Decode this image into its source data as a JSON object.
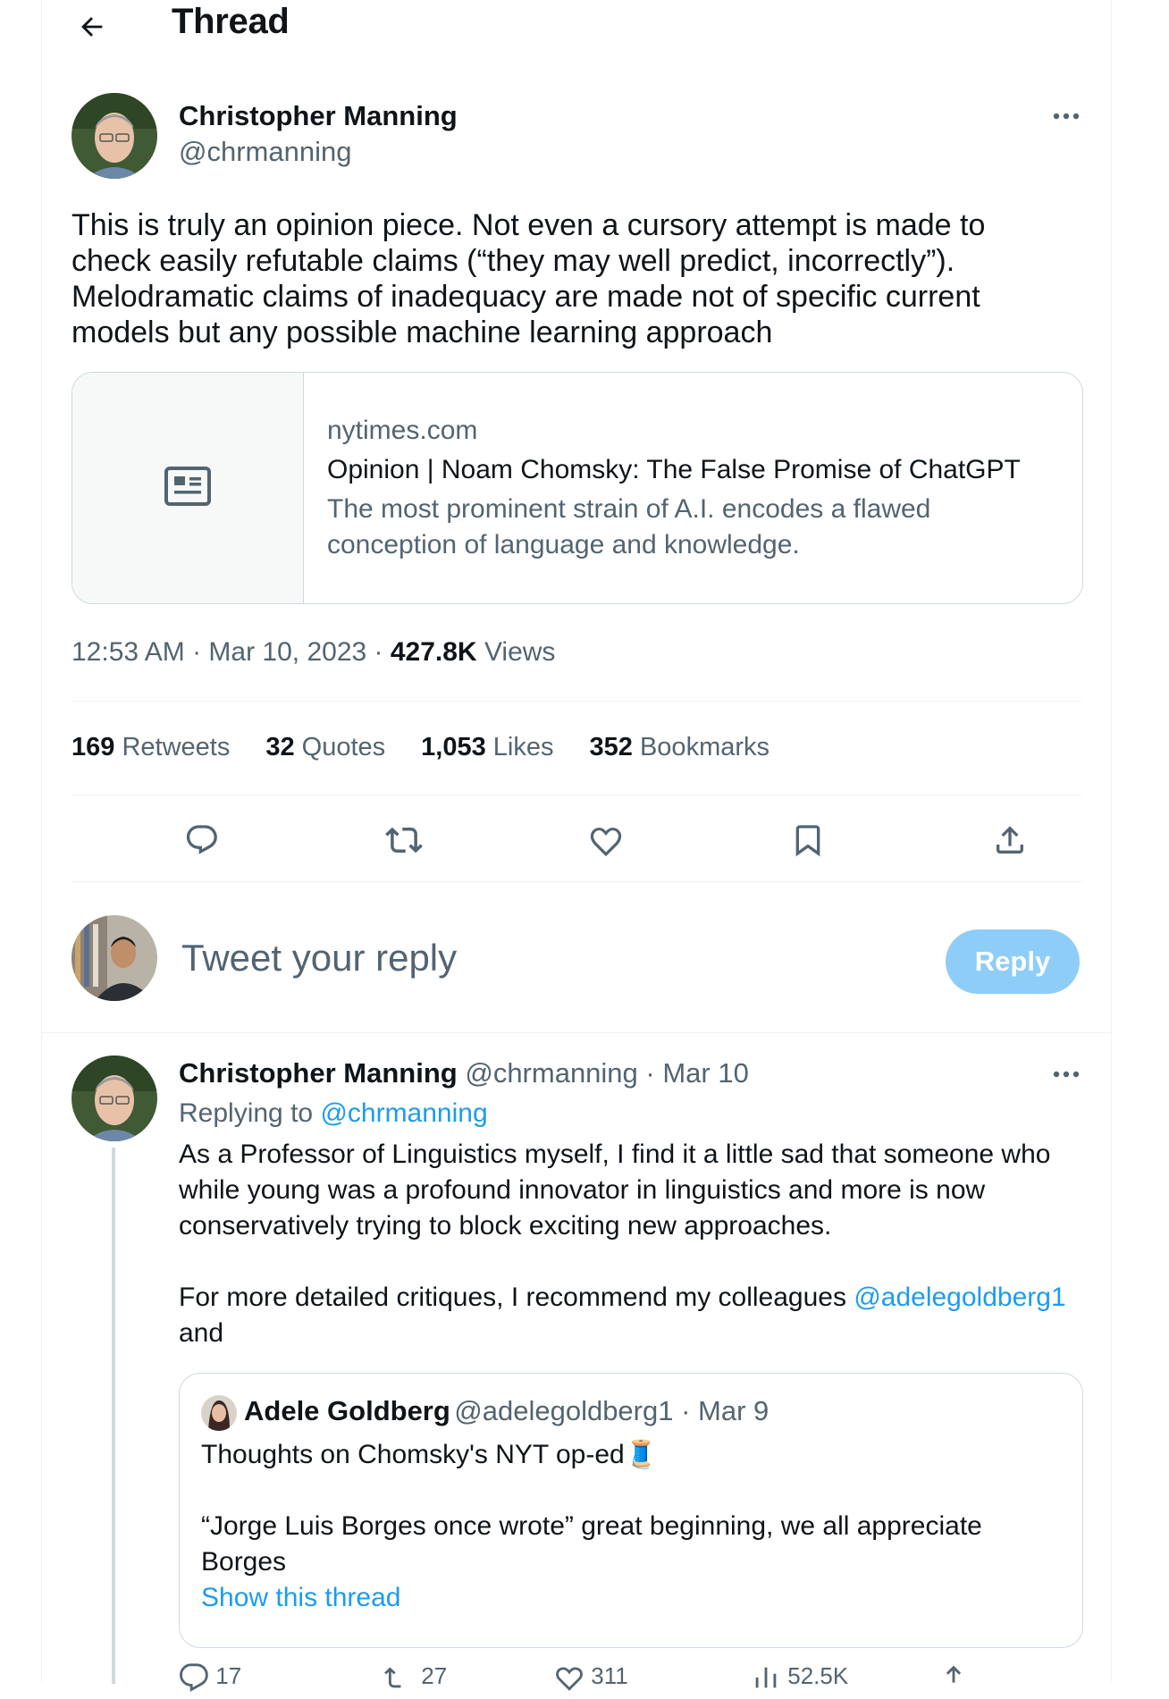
{
  "header": {
    "title": "Thread"
  },
  "main_tweet": {
    "author_name": "Christopher Manning",
    "author_handle": "@chrmanning",
    "text_lines": [
      "This is truly an opinion piece. Not even a cursory attempt is made to",
      "check easily refutable claims (“they may well predict, incorrectly”).",
      "Melodramatic claims of inadequacy are made not of specific current",
      "models but any possible machine learning approach"
    ],
    "card": {
      "domain": "nytimes.com",
      "title": "Opinion | Noam Chomsky: The False Promise of ChatGPT",
      "description": "The most prominent strain of A.I. encodes a flawed conception of language and knowledge."
    },
    "time": "12:53 AM · Mar 10, 2023 · ",
    "views_count": "427.8K",
    "views_label": " Views",
    "stats": {
      "retweets_count": "169",
      "retweets_label": " Retweets",
      "quotes_count": "32",
      "quotes_label": " Quotes",
      "likes_count": "1,053",
      "likes_label": " Likes",
      "bookmarks_count": "352",
      "bookmarks_label": " Bookmarks"
    }
  },
  "composer": {
    "placeholder": "Tweet your reply",
    "button_label": "Reply"
  },
  "reply_tweet": {
    "author_name": "Christopher Manning",
    "author_handle": "@chrmanning",
    "date": " · Mar 10",
    "replying_prefix": "Replying to ",
    "replying_handle": "@chrmanning",
    "text_lines": [
      "As a Professor of Linguistics myself, I find it a little sad that someone who",
      "while young was a profound innovator in linguistics and more is now",
      "conservatively trying to block exciting new approaches."
    ],
    "text2_prefix": "For more detailed critiques, I recommend my colleagues ",
    "text2_mention": "@adelegoldberg1",
    "text2_suffix": "and",
    "quote": {
      "author_name": "Adele Goldberg",
      "author_handle": "@adelegoldberg1",
      "date": " · Mar 9",
      "line1": "Thoughts on Chomsky's NYT op-ed🧵",
      "line2": "“Jorge Luis Borges once wrote” great beginning, we all appreciate",
      "line3": "Borges",
      "show_thread": "Show this thread"
    },
    "bottom_stats": {
      "replies": "17",
      "retweets": "27",
      "likes": "311",
      "views": "52.5K"
    }
  },
  "colors": {
    "accent": "#1d9bf0",
    "reply_button": "#8ecdf8",
    "muted": "#536471"
  }
}
